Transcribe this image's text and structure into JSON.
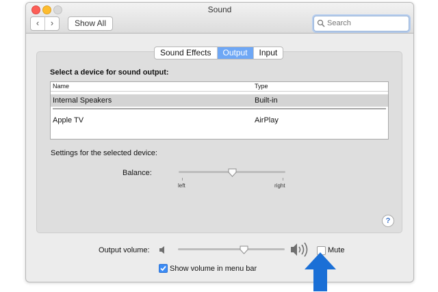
{
  "window": {
    "title": "Sound"
  },
  "toolbar": {
    "back": "‹",
    "forward": "›",
    "show_all": "Show All"
  },
  "search": {
    "placeholder": "Search",
    "value": ""
  },
  "tabs": [
    {
      "label": "Sound Effects",
      "active": false
    },
    {
      "label": "Output",
      "active": true
    },
    {
      "label": "Input",
      "active": false
    }
  ],
  "output": {
    "heading": "Select a device for sound output:",
    "columns": [
      "Name",
      "Type"
    ],
    "devices": [
      {
        "name": "Internal Speakers",
        "type": "Built-in",
        "selected": true
      },
      {
        "name": "Apple TV",
        "type": "AirPlay",
        "selected": false
      }
    ],
    "settings_label": "Settings for the selected device:",
    "balance": {
      "label": "Balance:",
      "left_label": "left",
      "right_label": "right",
      "value": 0.5
    }
  },
  "help": "?",
  "volume": {
    "label": "Output volume:",
    "level": 0.62,
    "mute_label": "Mute",
    "mute_checked": false,
    "menu_bar_label": "Show volume in menu bar",
    "menu_bar_checked": true
  },
  "annotation": {
    "arrow_color": "#1a6fd6"
  },
  "colors": {
    "accent": "#6ea7f5",
    "checkbox_checked": "#3b8bf5"
  }
}
